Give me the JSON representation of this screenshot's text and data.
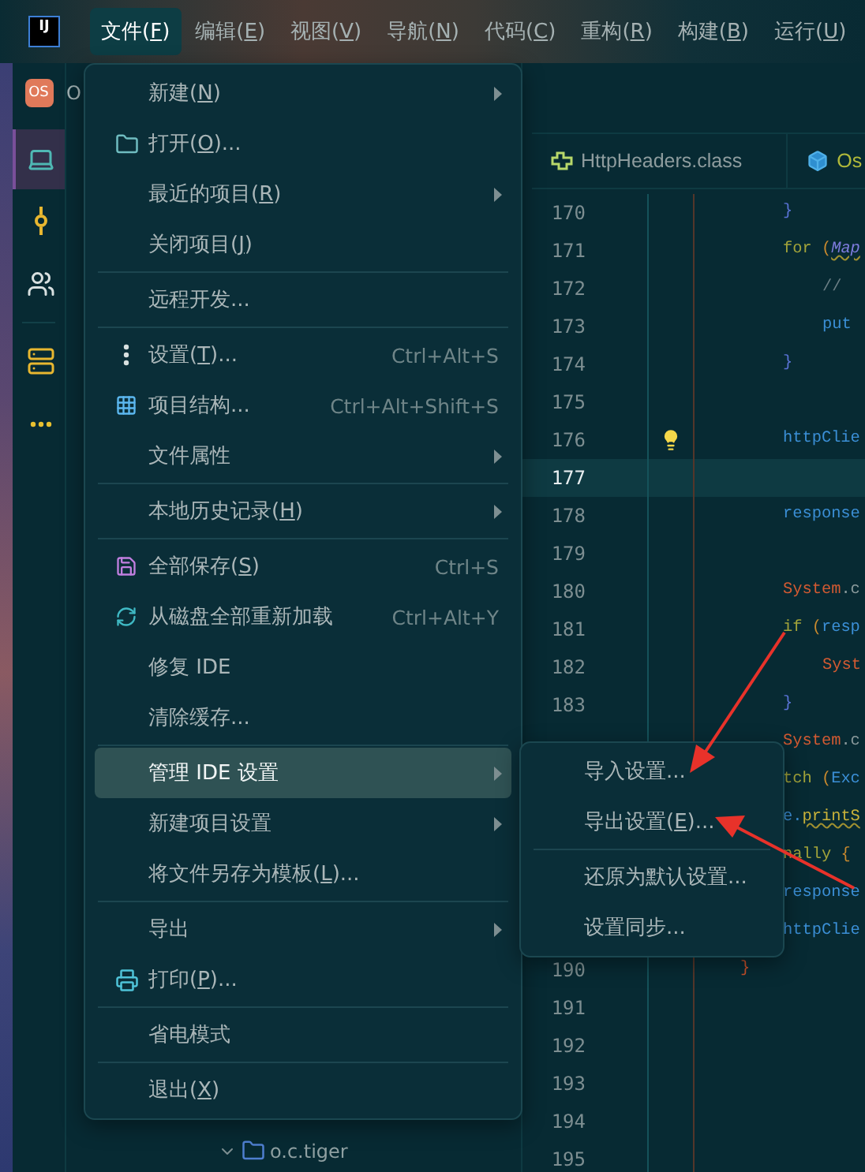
{
  "title_bar": {
    "logo": "IJ",
    "menus": [
      {
        "label": "文件(",
        "mnemonic": "F",
        "label_end": ")",
        "selected": true
      },
      {
        "label": "编辑(",
        "mnemonic": "E",
        "label_end": ")",
        "selected": false
      },
      {
        "label": "视图(",
        "mnemonic": "V",
        "label_end": ")",
        "selected": false
      },
      {
        "label": "导航(",
        "mnemonic": "N",
        "label_end": ")",
        "selected": false
      },
      {
        "label": "代码(",
        "mnemonic": "C",
        "label_end": ")",
        "selected": false
      },
      {
        "label": "重构(",
        "mnemonic": "R",
        "label_end": ")",
        "selected": false
      },
      {
        "label": "构建(",
        "mnemonic": "B",
        "label_end": ")",
        "selected": false
      },
      {
        "label": "运行(",
        "mnemonic": "U",
        "label_end": ")",
        "selected": false
      }
    ]
  },
  "activity_bar": {
    "project_badge": "OS",
    "project_name": "O",
    "tools": [
      {
        "kind": "laptop",
        "selected": true
      },
      {
        "kind": "commit",
        "selected": false
      },
      {
        "kind": "people",
        "selected": false
      },
      {
        "kind": "storage",
        "selected": false
      },
      {
        "kind": "more",
        "selected": false
      }
    ]
  },
  "project_tree": {
    "items": [
      {
        "label": "o.c.tiger",
        "expanded": true
      }
    ]
  },
  "editor": {
    "tabs": [
      {
        "label": "HttpHeaders.class",
        "kind": "class"
      },
      {
        "label": "Os",
        "kind": "module"
      }
    ],
    "lines": [
      {
        "number": "170",
        "kind": "body",
        "current": false,
        "bulb": false,
        "tokens": [
          {
            "text": "}",
            "kind": "brace"
          }
        ]
      },
      {
        "number": "171",
        "kind": "body",
        "current": false,
        "bulb": false,
        "tokens": [
          {
            "text": "for",
            "kind": "keyword"
          },
          {
            "text": " (",
            "kind": "paren"
          },
          {
            "text": "Map",
            "kind": "type"
          }
        ]
      },
      {
        "number": "172",
        "kind": "inner",
        "current": false,
        "bulb": false,
        "tokens": [
          {
            "text": "// ",
            "kind": "comment"
          }
        ]
      },
      {
        "number": "173",
        "kind": "inner",
        "current": false,
        "bulb": false,
        "tokens": [
          {
            "text": "put",
            "kind": "ident"
          }
        ]
      },
      {
        "number": "174",
        "kind": "body",
        "current": false,
        "bulb": false,
        "tokens": [
          {
            "text": "}",
            "kind": "brace"
          }
        ]
      },
      {
        "number": "175",
        "kind": "blank",
        "current": false,
        "bulb": false
      },
      {
        "number": "176",
        "kind": "body",
        "current": false,
        "bulb": true,
        "tokens": [
          {
            "text": "httpClie",
            "kind": "ident"
          }
        ]
      },
      {
        "number": "177",
        "kind": "blank",
        "current": true,
        "bulb": false
      },
      {
        "number": "178",
        "kind": "body",
        "current": false,
        "bulb": false,
        "tokens": [
          {
            "text": "response",
            "kind": "ident"
          }
        ]
      },
      {
        "number": "179",
        "kind": "blank",
        "current": false,
        "bulb": false
      },
      {
        "number": "180",
        "kind": "body",
        "current": false,
        "bulb": false,
        "tokens": [
          {
            "text": "System",
            "kind": "class"
          },
          {
            "text": ".c",
            "kind": "plain"
          }
        ]
      },
      {
        "number": "181",
        "kind": "body",
        "current": false,
        "bulb": false,
        "tokens": [
          {
            "text": "if",
            "kind": "keyword"
          },
          {
            "text": " (",
            "kind": "paren"
          },
          {
            "text": "resp",
            "kind": "ident"
          }
        ]
      },
      {
        "number": "182",
        "kind": "inner",
        "current": false,
        "bulb": false,
        "tokens": [
          {
            "text": "Syst",
            "kind": "class"
          }
        ]
      },
      {
        "number": "183",
        "kind": "body",
        "current": false,
        "bulb": false,
        "tokens": [
          {
            "text": "}",
            "kind": "brace"
          }
        ]
      },
      {
        "kind": "body",
        "current": false,
        "bulb": false,
        "tokens": [
          {
            "text": "System",
            "kind": "class"
          },
          {
            "text": ".c",
            "kind": "plain"
          }
        ]
      },
      {
        "kind": "body",
        "current": false,
        "bulb": false,
        "tokens": [
          {
            "text": "tch",
            "kind": "keyword"
          },
          {
            "text": " (",
            "kind": "paren"
          },
          {
            "text": "Exc",
            "kind": "ident"
          }
        ]
      },
      {
        "kind": "body",
        "current": false,
        "bulb": false,
        "tokens": [
          {
            "text": "e.",
            "kind": "ident"
          },
          {
            "text": "printS",
            "kind": "method"
          }
        ]
      },
      {
        "kind": "body",
        "current": false,
        "bulb": false,
        "tokens": [
          {
            "text": "nally",
            "kind": "keyword"
          },
          {
            "text": " {",
            "kind": "paren"
          }
        ]
      },
      {
        "kind": "body",
        "current": false,
        "bulb": false,
        "tokens": [
          {
            "text": "response",
            "kind": "ident"
          }
        ]
      },
      {
        "kind": "body",
        "current": false,
        "bulb": false,
        "tokens": [
          {
            "text": "httpClie",
            "kind": "ident"
          }
        ]
      },
      {
        "number": "190",
        "kind": "outer",
        "current": false,
        "bulb": false,
        "tokens": [
          {
            "text": "}",
            "kind": "closing"
          }
        ]
      },
      {
        "number": "191",
        "kind": "blank",
        "current": false,
        "bulb": false
      },
      {
        "number": "192",
        "kind": "blank",
        "current": false,
        "bulb": false
      },
      {
        "number": "193",
        "kind": "blank",
        "current": false,
        "bulb": false
      },
      {
        "number": "194",
        "kind": "blank",
        "current": false,
        "bulb": false
      },
      {
        "number": "195",
        "kind": "blank",
        "current": false,
        "bulb": false
      }
    ]
  },
  "file_menu": {
    "items": [
      {
        "kind": "item",
        "label": "新建(",
        "mnemonic": "N",
        "label_end": ")",
        "has_submenu": true,
        "selected": false
      },
      {
        "kind": "item",
        "label": "打开(",
        "mnemonic": "O",
        "label_end": ")...",
        "has_submenu": false,
        "selected": false
      },
      {
        "kind": "item",
        "label": "最近的项目(",
        "mnemonic": "R",
        "label_end": ")",
        "has_submenu": true,
        "selected": false
      },
      {
        "kind": "item",
        "label": "关闭项目(",
        "mnemonic": "J",
        "label_end": ")",
        "has_submenu": false,
        "selected": false
      },
      {
        "kind": "separator"
      },
      {
        "kind": "item",
        "label": "远程开发...",
        "has_submenu": false,
        "selected": false
      },
      {
        "kind": "separator"
      },
      {
        "kind": "item",
        "label": "设置(",
        "mnemonic": "T",
        "label_end": ")...",
        "shortcut": "Ctrl+Alt+S",
        "has_submenu": false,
        "selected": false
      },
      {
        "kind": "item",
        "label": "项目结构...",
        "shortcut": "Ctrl+Alt+Shift+S",
        "has_submenu": false,
        "selected": false
      },
      {
        "kind": "item",
        "label": "文件属性",
        "has_submenu": true,
        "selected": false
      },
      {
        "kind": "separator"
      },
      {
        "kind": "item",
        "label": "本地历史记录(",
        "mnemonic": "H",
        "label_end": ")",
        "has_submenu": true,
        "selected": false
      },
      {
        "kind": "separator"
      },
      {
        "kind": "item",
        "label": "全部保存(",
        "mnemonic": "S",
        "label_end": ")",
        "shortcut": "Ctrl+S",
        "has_submenu": false,
        "selected": false
      },
      {
        "kind": "item",
        "label": "从磁盘全部重新加载",
        "shortcut": "Ctrl+Alt+Y",
        "has_submenu": false,
        "selected": false
      },
      {
        "kind": "item",
        "label": "修复 IDE",
        "has_submenu": false,
        "selected": false
      },
      {
        "kind": "item",
        "label": "清除缓存...",
        "has_submenu": false,
        "selected": false
      },
      {
        "kind": "separator"
      },
      {
        "kind": "item",
        "label": "管理 IDE 设置",
        "has_submenu": true,
        "selected": true
      },
      {
        "kind": "item",
        "label": "新建项目设置",
        "has_submenu": true,
        "selected": false
      },
      {
        "kind": "item",
        "label": "将文件另存为模板(",
        "mnemonic": "L",
        "label_end": ")...",
        "has_submenu": false,
        "selected": false
      },
      {
        "kind": "separator"
      },
      {
        "kind": "item",
        "label": "导出",
        "has_submenu": true,
        "selected": false
      },
      {
        "kind": "item",
        "label": "打印(",
        "mnemonic": "P",
        "label_end": ")...",
        "has_submenu": false,
        "selected": false
      },
      {
        "kind": "separator"
      },
      {
        "kind": "item",
        "label": "省电模式",
        "has_submenu": false,
        "selected": false
      },
      {
        "kind": "separator"
      },
      {
        "kind": "item",
        "label": "退出(",
        "mnemonic": "X",
        "label_end": ")",
        "has_submenu": false,
        "selected": false
      }
    ]
  },
  "submenu": {
    "items": [
      {
        "kind": "item",
        "label": "导入设置...",
        "has_submenu": false,
        "selected": false
      },
      {
        "kind": "item",
        "label": "导出设置(",
        "mnemonic": "E",
        "label_end": ")...",
        "has_submenu": false,
        "selected": false
      },
      {
        "kind": "separator"
      },
      {
        "kind": "item",
        "label": "还原为默认设置...",
        "has_submenu": false,
        "selected": false
      },
      {
        "kind": "item",
        "label": "设置同步...",
        "has_submenu": false,
        "selected": false
      }
    ]
  },
  "annotations": [
    {
      "kind": "arrow"
    },
    {
      "kind": "arrow"
    }
  ]
}
